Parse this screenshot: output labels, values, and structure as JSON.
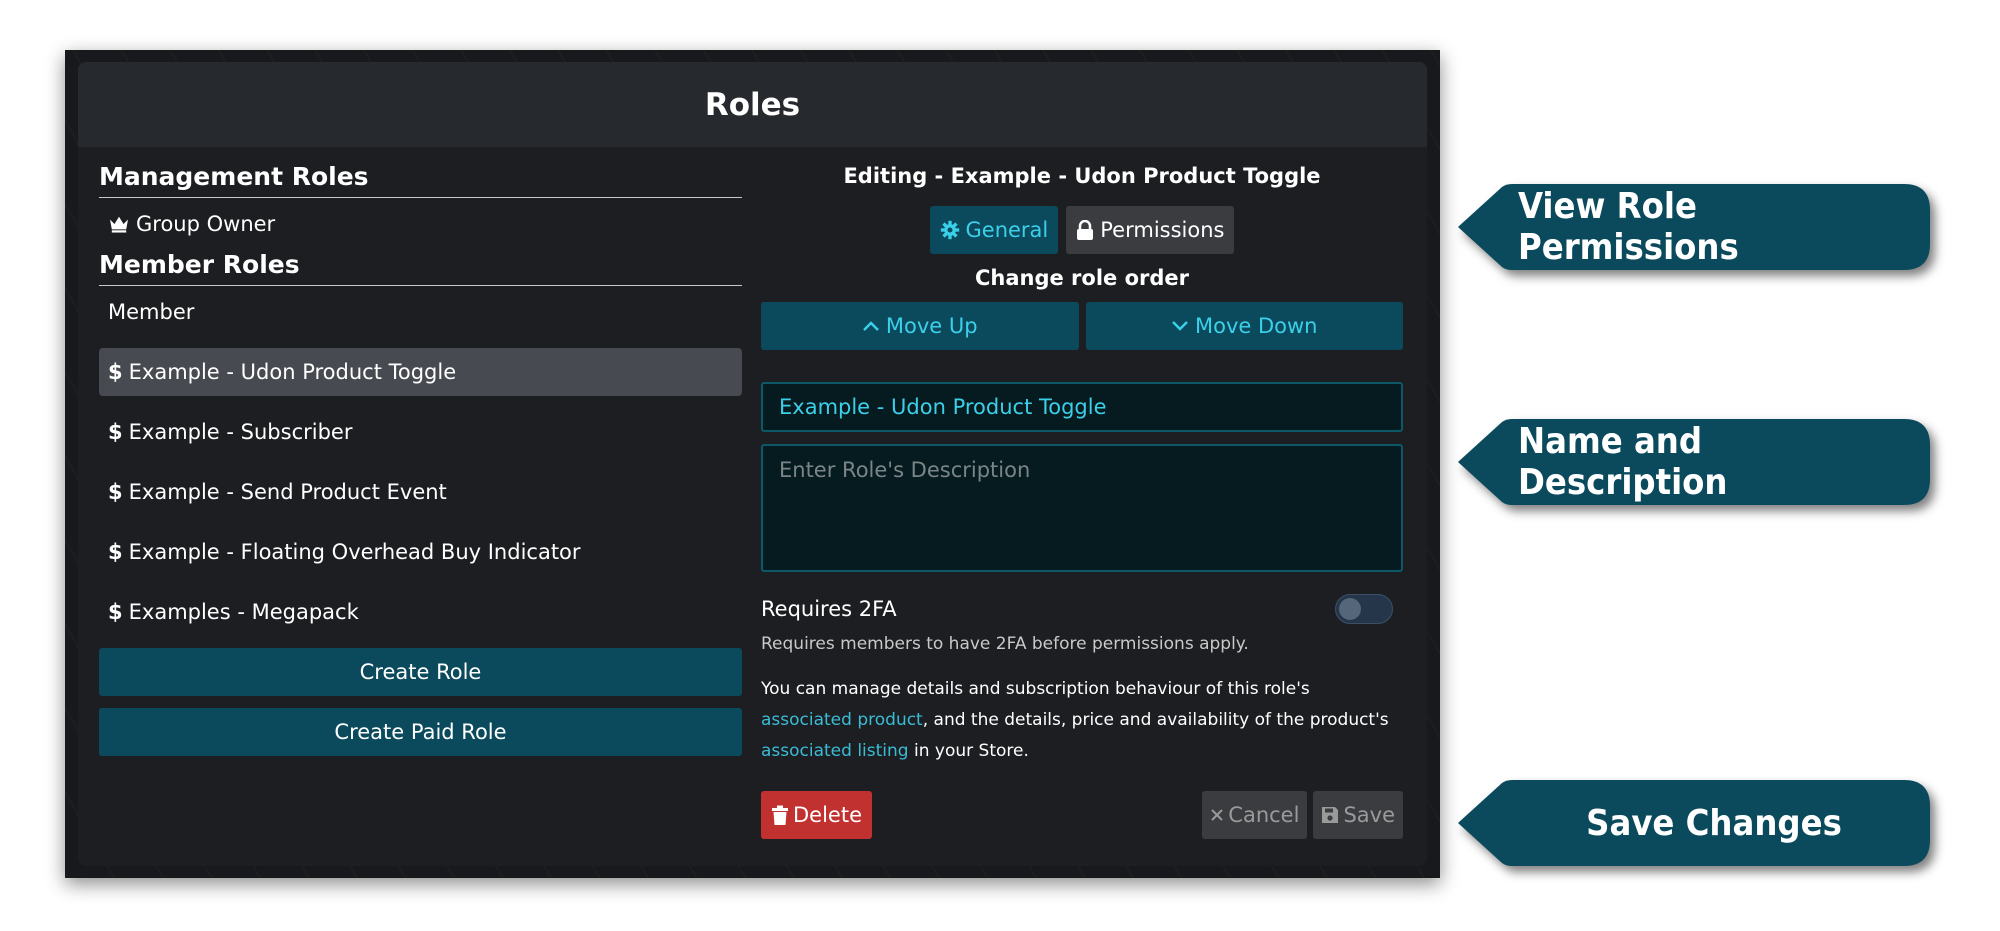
{
  "dialog": {
    "title": "Roles"
  },
  "left": {
    "management_title": "Management Roles",
    "management_roles": [
      {
        "label": "Group Owner",
        "icon": "crown-icon"
      }
    ],
    "member_title": "Member Roles",
    "member_roles": [
      {
        "label": "Member",
        "paid": false
      },
      {
        "label": "Example - Udon Product Toggle",
        "paid": true,
        "selected": true
      },
      {
        "label": "Example - Subscriber",
        "paid": true
      },
      {
        "label": "Example - Send Product Event",
        "paid": true
      },
      {
        "label": "Example - Floating Overhead Buy Indicator",
        "paid": true
      },
      {
        "label": "Examples - Megapack",
        "paid": true
      }
    ],
    "dollar_symbol": "$",
    "create_role": "Create Role",
    "create_paid_role": "Create Paid Role"
  },
  "editor": {
    "title": "Editing - Example - Udon Product Toggle",
    "tab_general": "General",
    "tab_permissions": "Permissions",
    "order_label": "Change role order",
    "move_up": "Move Up",
    "move_down": "Move Down",
    "name_value": "Example - Udon Product Toggle",
    "description_placeholder": "Enter Role's Description",
    "requires_2fa_label": "Requires 2FA",
    "requires_2fa_enabled": false,
    "requires_2fa_help": "Requires members to have 2FA before permissions apply.",
    "info_part1": "You can manage details and subscription behaviour of this role's ",
    "info_link1": "associated product",
    "info_part2": ", and the details, price and availability of the product's ",
    "info_link2": "associated listing",
    "info_part3": " in your Store.",
    "delete": "Delete",
    "cancel": "Cancel",
    "save": "Save"
  },
  "callouts": {
    "permissions": "View Role Permissions",
    "name_description": "Name and Description",
    "save": "Save Changes"
  },
  "colors": {
    "accent": "#0b4a5c",
    "accent_text": "#3bd0e9",
    "danger": "#c1312f",
    "callout": "#0b4a5c"
  }
}
